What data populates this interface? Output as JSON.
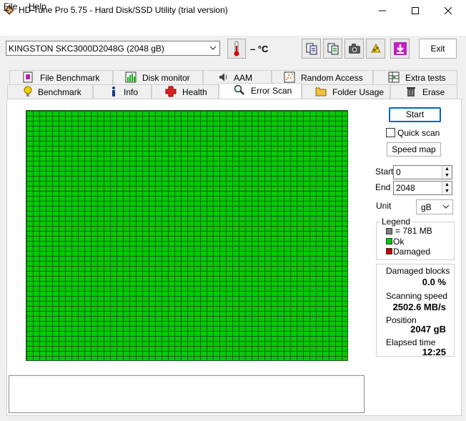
{
  "window": {
    "title": "HD Tune Pro 5.75 - Hard Disk/SSD Utility (trial version)"
  },
  "menu": {
    "file": "File",
    "help": "Help"
  },
  "toolbar": {
    "drive": "KINGSTON SKC3000D2048G (2048 gB)",
    "temperature": "– °C",
    "exit_label": "Exit",
    "icons": [
      "copy-icon",
      "copy-info-icon",
      "screenshot-camera-icon",
      "options-icon",
      "save-download-icon"
    ]
  },
  "tabs": {
    "row1": [
      {
        "label": "File Benchmark",
        "icon": "file-benchmark-icon"
      },
      {
        "label": "Disk monitor",
        "icon": "disk-monitor-icon"
      },
      {
        "label": "AAM",
        "icon": "speaker-icon"
      },
      {
        "label": "Random Access",
        "icon": "random-access-icon"
      },
      {
        "label": "Extra tests",
        "icon": "extra-tests-icon"
      }
    ],
    "row2": [
      {
        "label": "Benchmark",
        "icon": "bulb-icon"
      },
      {
        "label": "Info",
        "icon": "info-icon"
      },
      {
        "label": "Health",
        "icon": "health-cross-icon"
      },
      {
        "label": "Error Scan",
        "icon": "magnifier-icon"
      },
      {
        "label": "Folder Usage",
        "icon": "folder-icon"
      },
      {
        "label": "Erase",
        "icon": "trash-icon"
      }
    ]
  },
  "controls": {
    "start_label": "Start",
    "quick_scan_label": "Quick scan",
    "quick_scan_checked": false,
    "speed_map_label": "Speed map",
    "start_field_label": "Start",
    "start_value": "0",
    "end_field_label": "End",
    "end_value": "2048",
    "unit_label": "Unit",
    "unit_value": "gB"
  },
  "legend": {
    "title": "Legend",
    "items": [
      {
        "label": "= 781 MB",
        "color": "#808080"
      },
      {
        "label": "Ok",
        "color": "#00cc00"
      },
      {
        "label": "Damaged",
        "color": "#cc0000"
      }
    ]
  },
  "stats": {
    "damaged_label": "Damaged blocks",
    "damaged_value": "0.0 %",
    "speed_label": "Scanning speed",
    "speed_value": "2502.6 MB/s",
    "position_label": "Position",
    "position_value": "2047 gB",
    "elapsed_label": "Elapsed time",
    "elapsed_value": "12:25"
  },
  "scan_map": {
    "status": "all blocks ok",
    "color": "#00cc00"
  }
}
